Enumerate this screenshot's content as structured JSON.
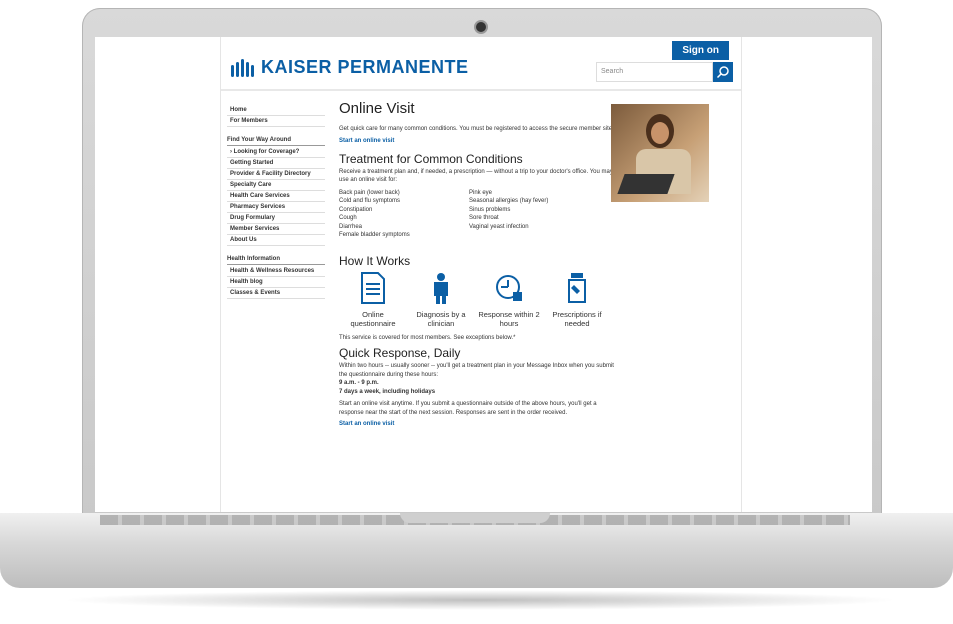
{
  "header": {
    "logo_text": "KAISER PERMANENTE",
    "signon": "Sign on",
    "search_placeholder": "Search"
  },
  "nav": {
    "items": [
      "Home",
      "For Members",
      "Find Your Way Around",
      "› Looking for Coverage?",
      "Getting Started",
      "Provider & Facility Directory",
      "Specialty Care",
      "Health Care Services",
      "Pharmacy Services",
      "Drug Formulary",
      "Member Services",
      "About Us",
      "Health Information",
      "Health & Wellness Resources",
      "Health blog",
      "Classes & Events"
    ]
  },
  "main": {
    "title": "Online Visit",
    "intro": "Get quick care for many common conditions. You must be registered to access the secure member site.",
    "start_link": "Start an online visit",
    "treatment_title": "Treatment for Common Conditions",
    "treatment_text": "Receive a treatment plan and, if needed, a prescription — without a trip to your doctor's office. You may use an online visit for:",
    "conditions_left": [
      "Back pain (lower back)",
      "Cold and flu symptoms",
      "Constipation",
      "Cough",
      "Diarrhea",
      "Female bladder symptoms"
    ],
    "conditions_right": [
      "Pink eye",
      "Seasonal allergies (hay fever)",
      "Sinus problems",
      "Sore throat",
      "Vaginal yeast infection"
    ],
    "how_title": "How It Works",
    "how_items": [
      "Online questionnaire",
      "Diagnosis by a clinician",
      "Response within 2 hours",
      "Prescriptions if needed"
    ],
    "coverage": "This service is covered for most members. See exceptions below.*",
    "quick_title": "Quick Response, Daily",
    "quick_text": "Within two hours -- usually sooner -- you'll get a treatment plan in your Message Inbox when you submit the questionnaire during these hours:",
    "hours": "9 a.m. - 9 p.m.",
    "days": "7 days a week, including holidays",
    "anytime_text": "Start an online visit anytime. If you submit a questionnaire outside of the above hours, you'll get a response near the start of the next session. Responses are sent in the order received.",
    "start_link2": "Start an online visit"
  }
}
